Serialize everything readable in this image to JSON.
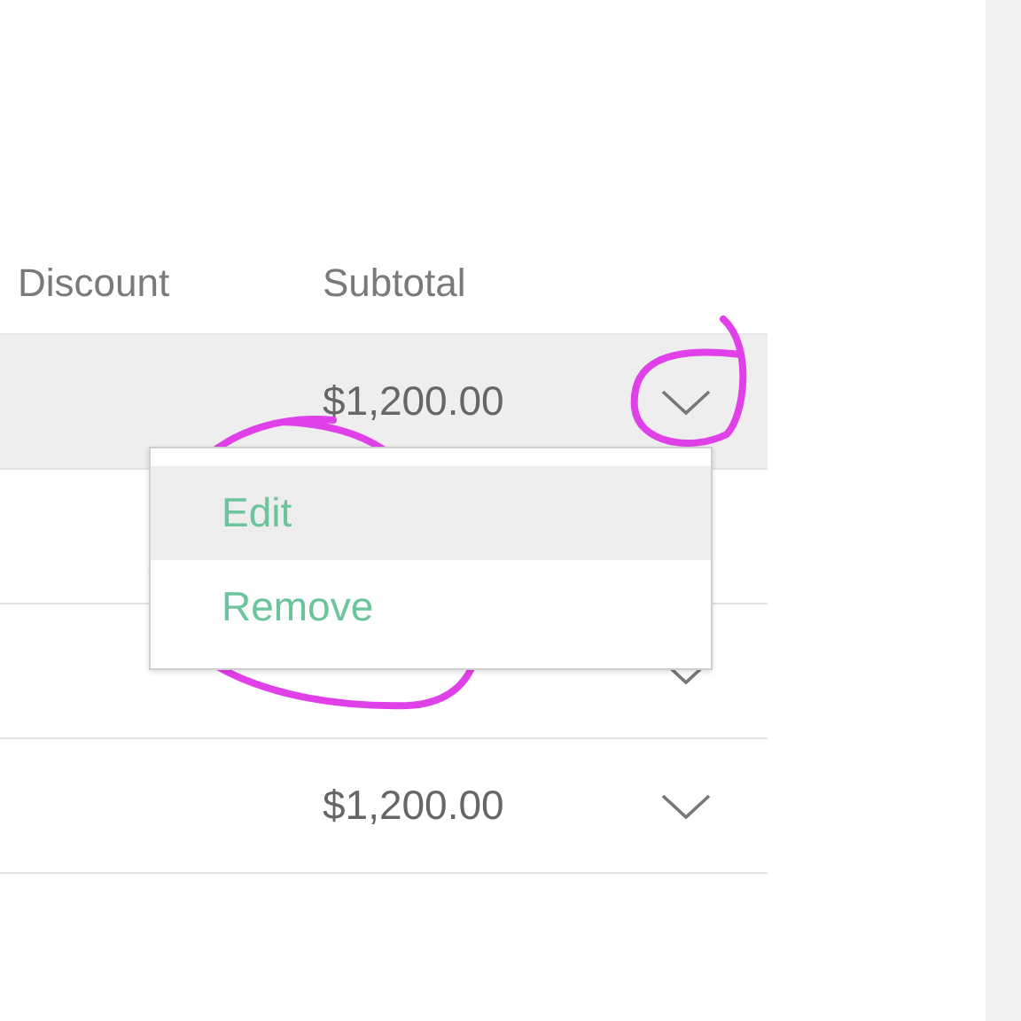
{
  "table": {
    "columns": [
      "Discount",
      "Subtotal"
    ],
    "rows": [
      {
        "subtotal": "$1,200.00",
        "highlighted": true,
        "kind": "menu-open"
      },
      {
        "highlighted": false,
        "kind": "plain"
      },
      {
        "highlighted": false,
        "kind": "plain"
      },
      {
        "subtotal": "$1,200.00",
        "highlighted": false,
        "kind": "plain"
      }
    ]
  },
  "row_menu": {
    "items": [
      {
        "label": "Edit",
        "selected": true
      },
      {
        "label": "Remove",
        "selected": false
      }
    ]
  }
}
